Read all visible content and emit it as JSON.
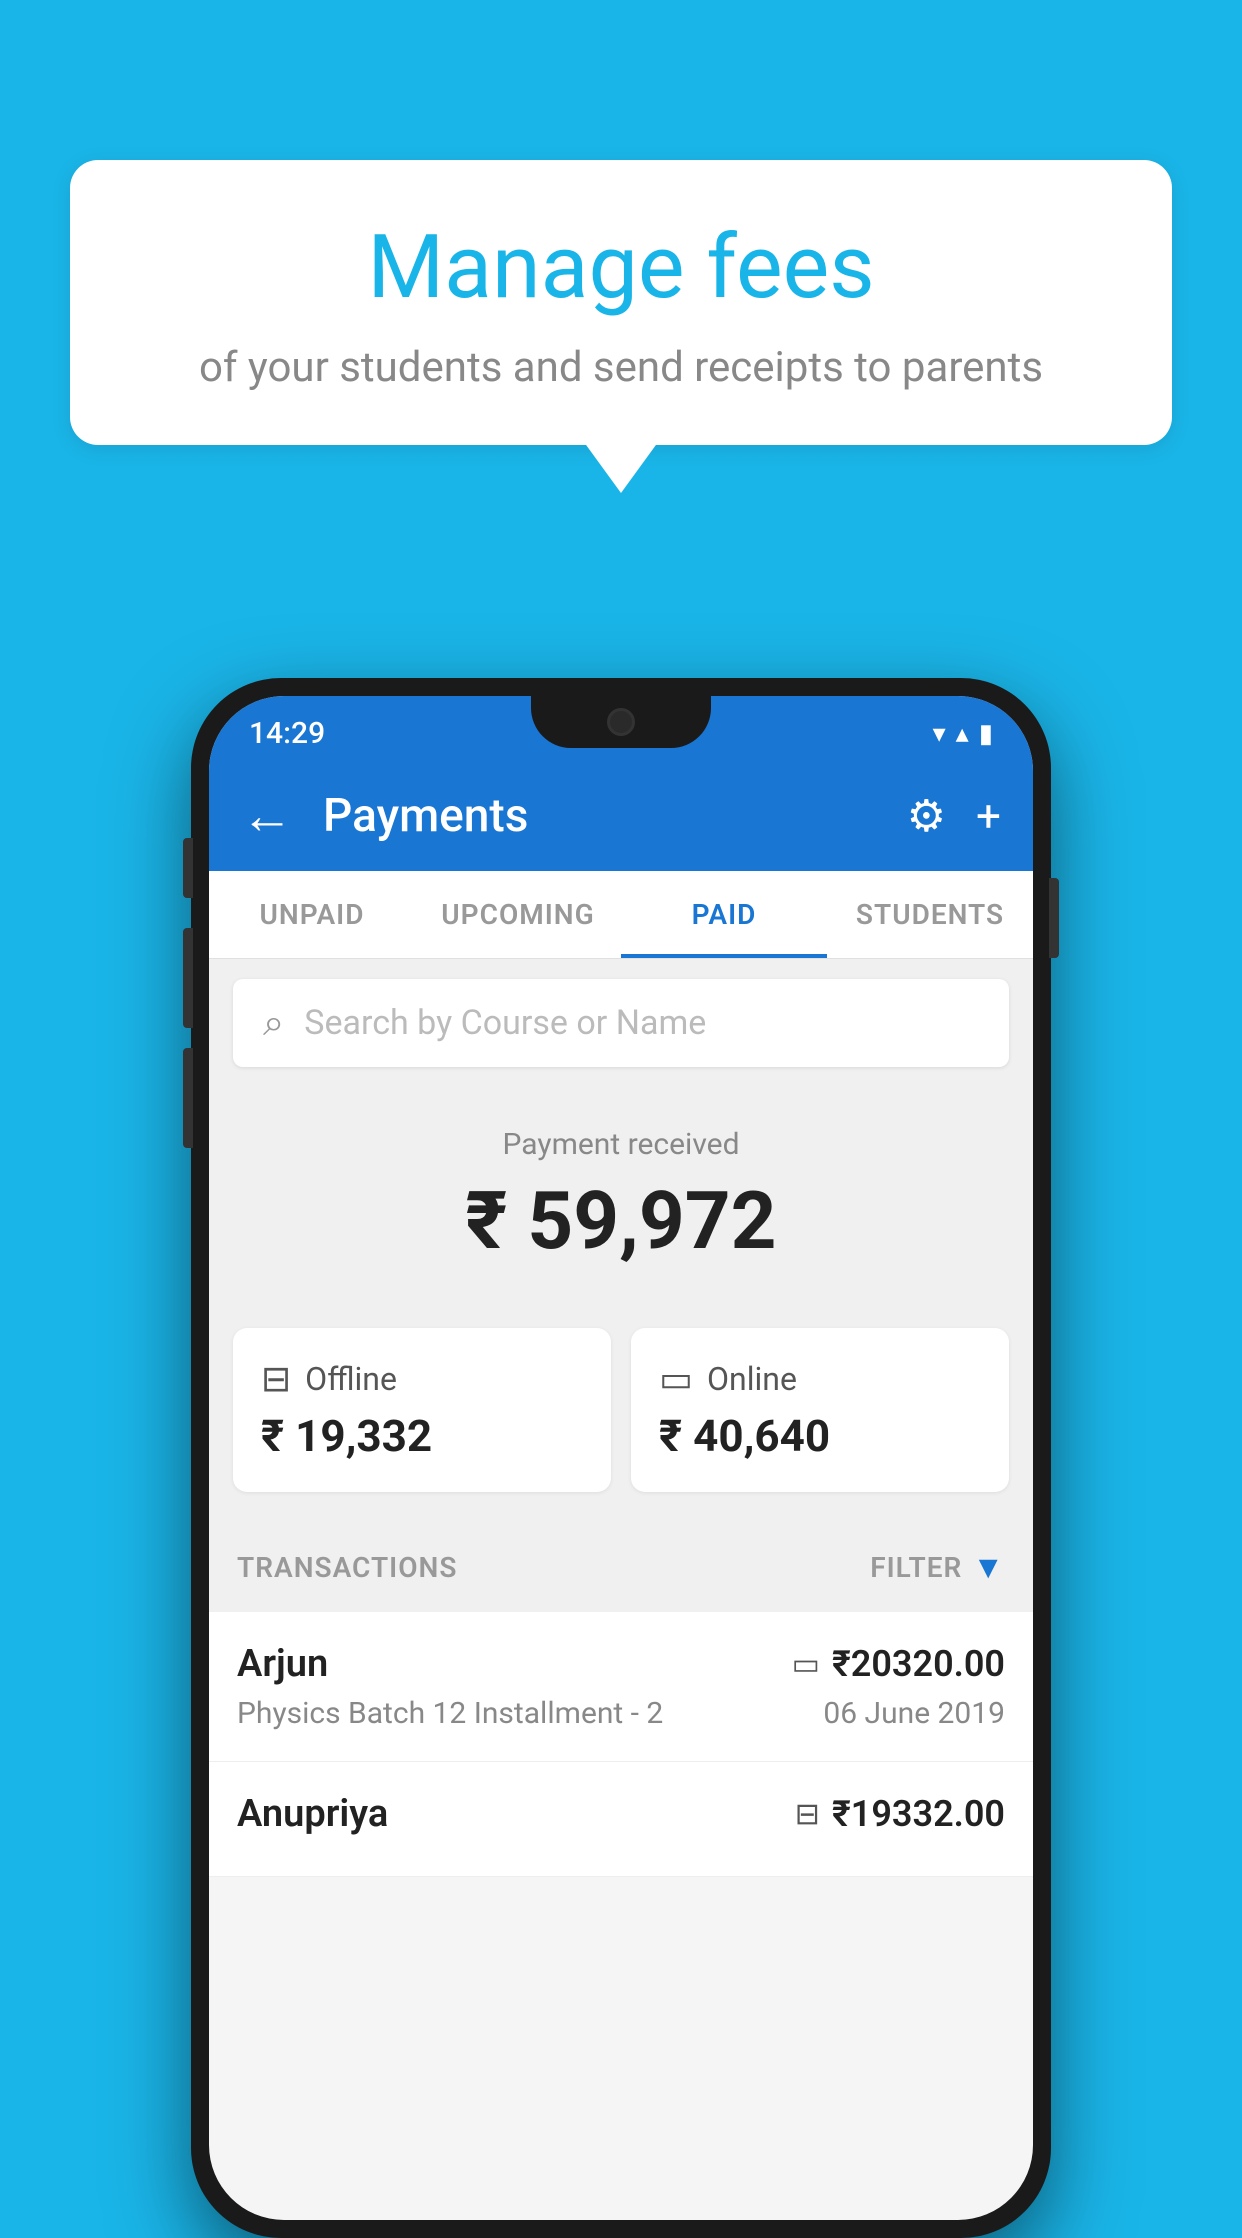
{
  "background_color": "#1ab5e8",
  "speech_bubble": {
    "title": "Manage fees",
    "subtitle": "of your students and send receipts to parents"
  },
  "status_bar": {
    "time": "14:29",
    "wifi_icon": "▼",
    "signal_icon": "▲",
    "battery_icon": "▮"
  },
  "app_bar": {
    "title": "Payments",
    "back_label": "←",
    "settings_label": "⚙",
    "add_label": "+"
  },
  "tabs": [
    {
      "label": "UNPAID",
      "active": false
    },
    {
      "label": "UPCOMING",
      "active": false
    },
    {
      "label": "PAID",
      "active": true
    },
    {
      "label": "STUDENTS",
      "active": false
    }
  ],
  "search": {
    "placeholder": "Search by Course or Name"
  },
  "payment_summary": {
    "label": "Payment received",
    "total_amount": "₹ 59,972",
    "offline": {
      "label": "Offline",
      "amount": "₹ 19,332"
    },
    "online": {
      "label": "Online",
      "amount": "₹ 40,640"
    }
  },
  "transactions": {
    "header_label": "TRANSACTIONS",
    "filter_label": "FILTER",
    "items": [
      {
        "name": "Arjun",
        "amount": "₹20320.00",
        "course": "Physics Batch 12 Installment - 2",
        "date": "06 June 2019",
        "payment_type": "online"
      },
      {
        "name": "Anupriya",
        "amount": "₹19332.00",
        "course": "",
        "date": "",
        "payment_type": "offline"
      }
    ]
  }
}
